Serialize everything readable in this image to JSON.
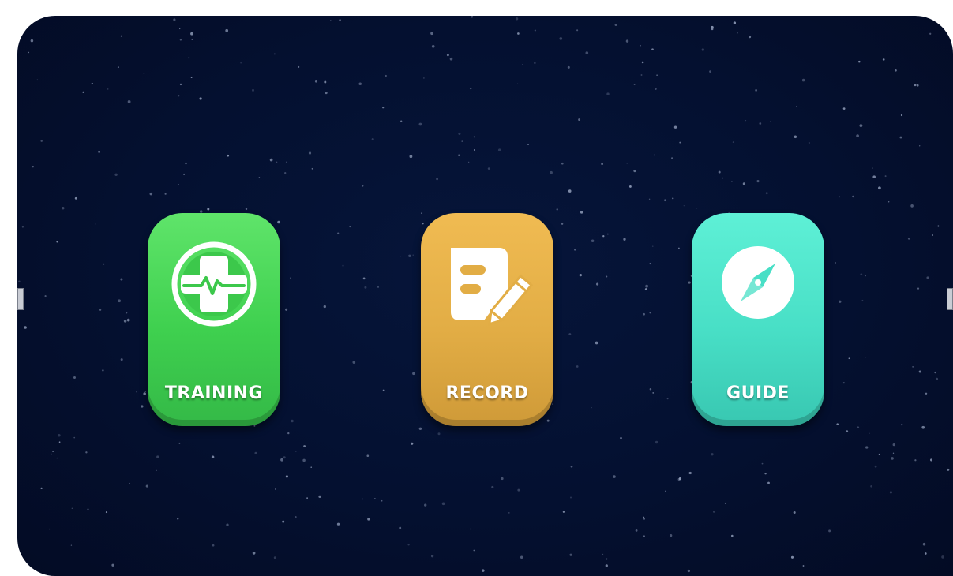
{
  "menu": {
    "items": [
      {
        "id": "training",
        "label": "TRAINING",
        "color": "#43d552",
        "icon": "medical-cross-heartbeat-icon"
      },
      {
        "id": "record",
        "label": "RECORD",
        "color": "#e2ad45",
        "icon": "note-pencil-icon"
      },
      {
        "id": "guide",
        "label": "GUIDE",
        "color": "#48dfc6",
        "icon": "compass-icon"
      }
    ]
  },
  "theme": {
    "background": "#041030",
    "star_color": "#9aa6c2"
  }
}
